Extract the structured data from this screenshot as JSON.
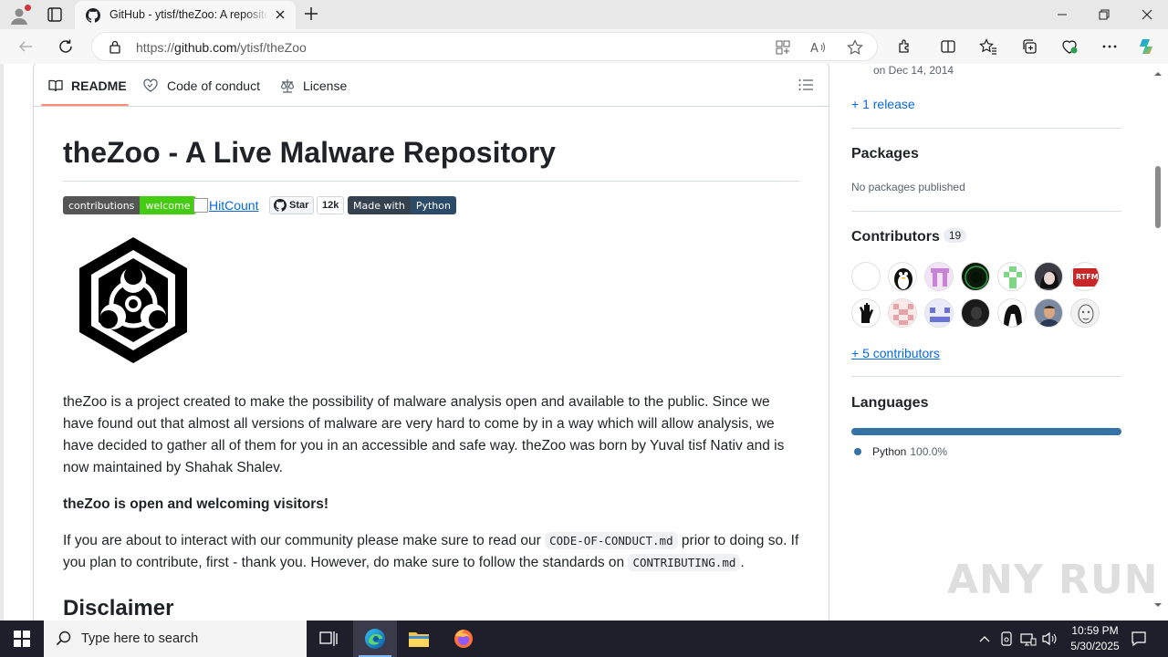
{
  "browser": {
    "tab_title": "GitHub - ytisf/theZoo: A repository of LIVE malwares",
    "url_prefix": "https://",
    "url_host": "github.com",
    "url_path": "/ytisf/theZoo"
  },
  "readme": {
    "tabs": [
      {
        "label": "README"
      },
      {
        "label": "Code of conduct"
      },
      {
        "label": "License"
      }
    ],
    "title": "theZoo - A Live Malware Repository",
    "badges": {
      "contributions_left": "contributions",
      "contributions_right": "welcome",
      "hitcount_alt": "HitCount",
      "star_label": "Star",
      "star_count": "12k",
      "made_with_left": "Made with",
      "made_with_right": "Python"
    },
    "paragraph1": "theZoo is a project created to make the possibility of malware analysis open and available to the public. Since we have found out that almost all versions of malware are very hard to come by in a way which will allow analysis, we have decided to gather all of them for you in an accessible and safe way. theZoo was born by Yuval tisf Nativ and is now maintained by Shahak Shalev.",
    "paragraph2": "theZoo is open and welcoming visitors!",
    "paragraph3_a": "If you are about to interact with our community please make sure to read our ",
    "paragraph3_code1": "CODE-OF-CONDUCT.md",
    "paragraph3_b": " prior to doing so. If you plan to contribute, first - thank you. However, do make sure to follow the standards on ",
    "paragraph3_code2": "CONTRIBUTING.md",
    "paragraph3_c": ".",
    "heading2": "Disclaimer"
  },
  "sidebar": {
    "release_date": "on Dec 14, 2014",
    "releases_link": "+ 1 release",
    "packages_heading": "Packages",
    "packages_text": "No packages published",
    "contributors_heading": "Contributors",
    "contributors_count": "19",
    "contributors_link": "+ 5 contributors",
    "languages_heading": "Languages",
    "language_name": "Python",
    "language_pct": "100.0%",
    "language_color": "#3572a5",
    "language_fraction": 1.0
  },
  "watermark": "ANY RUN",
  "taskbar": {
    "search_placeholder": "Type here to search",
    "time": "10:59 PM",
    "date": "5/30/2025"
  }
}
